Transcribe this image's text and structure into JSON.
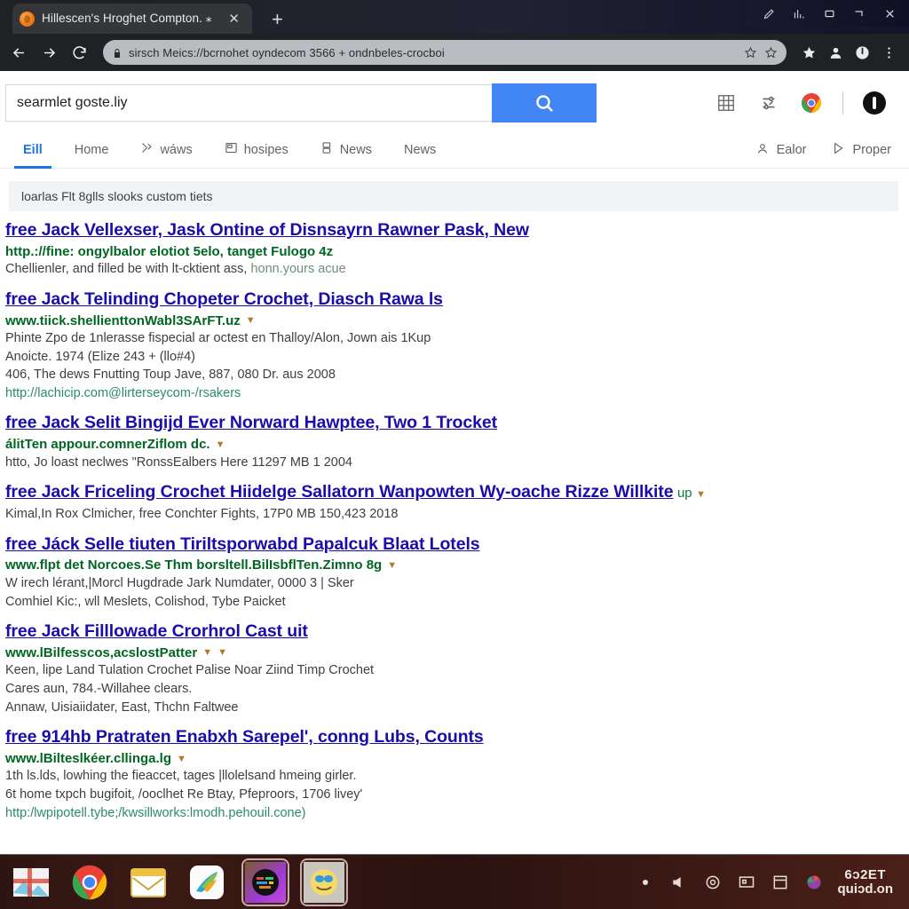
{
  "browser": {
    "tab": {
      "title": "Hillescen's Hroghet Compton. ⁎",
      "close_label": "✕",
      "favicon": "orange-circle-favicon"
    },
    "newtab_label": "+",
    "window_controls": [
      "pencil-icon",
      "chart-icon",
      "maximize-icon",
      "restore-icon",
      "close-icon"
    ],
    "nav": {
      "back": "←",
      "forward": "→",
      "reload": "⟳"
    },
    "omnibox": {
      "text": "sirsch  Meics://bcrnohet oyndecom 3566 + ondnbeles-crocboi",
      "lock": "lock-icon"
    },
    "toolbar_icons": [
      "bookmark-star-icon",
      "profile-icon",
      "power-icon",
      "menu-dots-icon"
    ]
  },
  "search": {
    "value": "searmlet goste.liy",
    "placeholder": "Search",
    "button_icon": "search-icon"
  },
  "header_right": {
    "icons": [
      "apps-grid-icon",
      "settings-icon",
      "chrome-logo-icon",
      "account-avatar-icon"
    ]
  },
  "nav_tabs": [
    {
      "label": "Eill",
      "icon": "",
      "active": true
    },
    {
      "label": "Home",
      "icon": "",
      "active": false
    },
    {
      "label": "wáws",
      "icon": "tools-icon",
      "active": false
    },
    {
      "label": "hosipes",
      "icon": "news-card-icon",
      "active": false
    },
    {
      "label": "News",
      "icon": "books-icon",
      "active": false
    },
    {
      "label": "News",
      "icon": "",
      "active": false
    }
  ],
  "nav_tabs_right": [
    {
      "label": "Ealor",
      "icon": "person-location-icon"
    },
    {
      "label": "Proper",
      "icon": "play-icon"
    }
  ],
  "tools_bar": {
    "label": "loarlas Flt 8glls slooks custom tiets"
  },
  "results": [
    {
      "title": "free Jack Vellexser, Jask Ontine of Disnsayrn Rawner Pask, New",
      "title_suffix": "",
      "url": "http.://fine: ongylbalor elotiot 5elo, tanget Fulogo 4z",
      "url_caret": false,
      "snippet_lines": [
        "Chellienler, and filled be with lt-cktient ass,"
      ],
      "snippet_muted": "honn.yours acue",
      "extra_link": ""
    },
    {
      "title": "free Jack Telinding Chopeter Crochet, Diasch Rawa ls",
      "title_suffix": "",
      "url": "www.tiick.shellienttonWabl3SArFT.uz",
      "url_caret": true,
      "snippet_lines": [
        "Phinte Zpo de 1nlerasse fispecial ar octest en Thalloy/Alon, Jown ais 1Kup",
        "Anoicte. 1974  (Elize 243 + (llo#4)",
        "406, The dews Fnutting Toup  Jave, 887, 080 Dr. aus 2008"
      ],
      "snippet_muted": "",
      "extra_link": "http://lachicip.com@lirterseycom-/rsakers"
    },
    {
      "title": "free Jack Selit Bingijd Ever Norward Hawptee, Two 1 Trocket",
      "title_suffix": "",
      "url": "álitTen appour.comnerZiflom dc.",
      "url_caret": true,
      "snippet_lines": [
        "htto, Jo loast neclwes \"RonssEalbers Here 11297 MB 1 2004"
      ],
      "snippet_muted": "",
      "extra_link": ""
    },
    {
      "title": "free Jack Friceling Crochet Hiidelge Sallatorn Wanpowten Wy-oache Rizze Willkite",
      "title_suffix": "up",
      "url": "",
      "url_caret": true,
      "snippet_lines": [
        "Kimal,In Rox Clmicher, free Conchter Fights, 17P0 MB 150,423 2018"
      ],
      "snippet_muted": "",
      "extra_link": ""
    },
    {
      "title": "free Jáck Selle tiuten Tiriltsporwabd Papalcuk Blaat Lotels",
      "title_suffix": "",
      "url": "www.flpt det Norcoes.Se Thm borsltell.BilIsbflTen.Zimno 8g",
      "url_caret": true,
      "snippet_lines": [
        "W irech lérant,|Morcl Hugdrade Jark Numdater, 0000 3 | Sker",
        "Comhiel Kic:, wll Meslets, Colishod, Tybe Paicket"
      ],
      "snippet_muted": "",
      "extra_link": ""
    },
    {
      "title": "free Jack Filllowade Crorhrol Cast uit",
      "title_suffix": "",
      "url": "www.lBilfesscos,acslostPatter",
      "url_caret": true,
      "url_caret2": true,
      "snippet_lines": [
        "Keen, lipe Land Tulation Crochet Palise Noar Ziind Timp Crochet",
        "Cares aun, 784.-Willahee clears.",
        "Annaw, Uisiaiidater, East, Thchn Faltwee"
      ],
      "snippet_muted": "",
      "extra_link": ""
    },
    {
      "title": "free 914hb Pratraten Enabxh Sarерel', conng Lubs, Counts",
      "title_suffix": "",
      "url": "www.lBilteslkéer.cllinga.lg",
      "url_caret": true,
      "snippet_lines": [
        "1th ls.lds, lowhing the fieaccet, tages |llolelsand hmeing girler.",
        "6t home txpch bugifoit, /ooclhet Re Btay, Pfeproors, 1706 livey'"
      ],
      "snippet_muted": "",
      "extra_link": "http:/lwpipotell.tybe;/kwsillworks:lmodh.pehouil.cone)"
    }
  ],
  "taskbar": {
    "apps": [
      "windows-photo-icon",
      "chrome-icon",
      "mail-icon",
      "paint-icon",
      "media-dark-icon",
      "emoji-icon"
    ],
    "tray_icons": [
      "dot-icon",
      "volume-icon",
      "network-icon",
      "display-icon",
      "window-icon",
      "colorful-icon"
    ],
    "clock_line1": "6ɔ2ET",
    "clock_line2": "quiɔd.on"
  },
  "colors": {
    "accent_blue": "#1a73e8",
    "link_blue": "#1a0dab",
    "url_green": "#006621",
    "search_button": "#4285f4"
  }
}
